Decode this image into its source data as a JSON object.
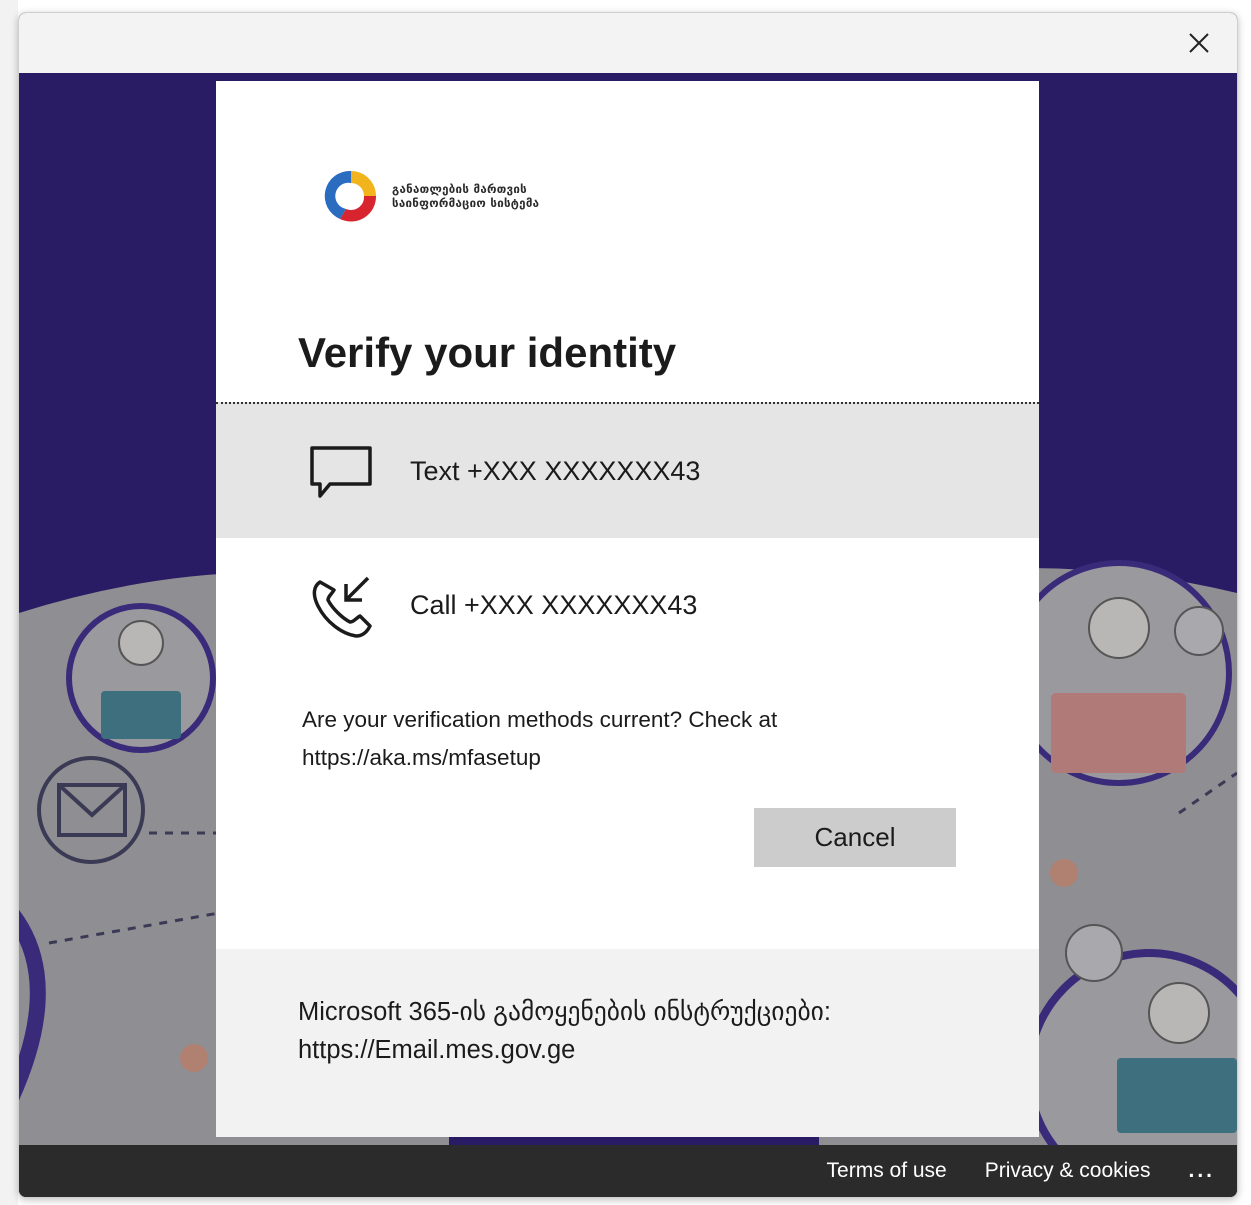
{
  "window": {
    "close_label": "×"
  },
  "organization": {
    "logo_line1": "განათლების მართვის",
    "logo_line2": "საინფორმაციო სისტემა"
  },
  "dialog": {
    "title": "Verify your identity",
    "options": [
      {
        "icon": "chat-bubble-icon",
        "label": "Text +XXX XXXXXXX43"
      },
      {
        "icon": "phone-call-icon",
        "label": "Call +XXX XXXXXXX43"
      }
    ],
    "hint_line1": "Are your verification methods current? Check at",
    "hint_line2": "https://aka.ms/mfasetup",
    "cancel_label": "Cancel",
    "footer_line1": "Microsoft 365-ის გამოყენების ინსტრუქციები:",
    "footer_line2": "https://Email.mes.gov.ge"
  },
  "bottom_bar": {
    "terms": "Terms of use",
    "privacy": "Privacy & cookies",
    "more": "..."
  },
  "colors": {
    "backdrop_purple": "#2a1c64",
    "selected_option": "#e5e5e5",
    "cancel_button": "#cccccc",
    "bottom_bar": "#2b2b2b"
  }
}
